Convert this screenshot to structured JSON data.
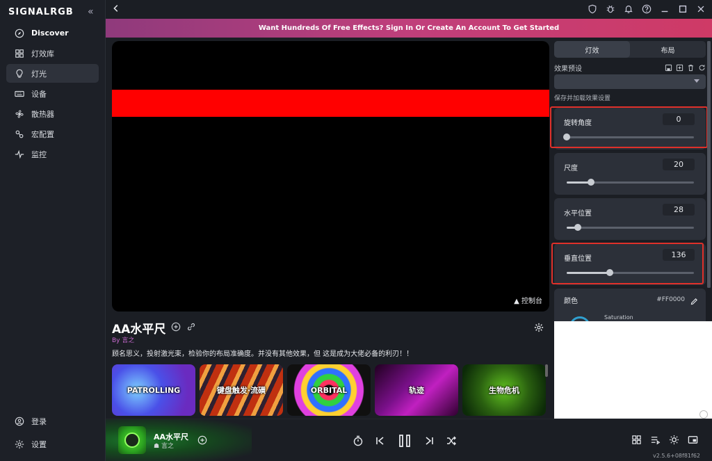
{
  "sidebar": {
    "logo": "SIGNALRGB",
    "collapse": "«",
    "items": [
      {
        "label": "Discover"
      },
      {
        "label": "灯效库"
      },
      {
        "label": "灯光"
      },
      {
        "label": "设备"
      },
      {
        "label": "散热器"
      },
      {
        "label": "宏配置"
      },
      {
        "label": "监控"
      }
    ],
    "bottom": [
      {
        "label": "登录"
      },
      {
        "label": "设置"
      }
    ]
  },
  "banner": {
    "text": "Want Hundreds Of Free Effects? Sign In Or Create An Account To Get Started"
  },
  "preview": {
    "console_label": "▲ 控制台",
    "effect_color": "#FF0000"
  },
  "effect": {
    "title": "AA水平尺",
    "author_prefix": "By",
    "author": "言之",
    "description": "顾名思义，投射激光束，检验你的布局准确度。并没有其他效果，但 这是成为大佬必备的利刃！！"
  },
  "thumbnails": [
    {
      "label": "PATROLLING"
    },
    {
      "label": "键盘触发·流磺"
    },
    {
      "label": "ORBITAL"
    },
    {
      "label": "轨迹"
    },
    {
      "label": "生物危机"
    }
  ],
  "right_panel": {
    "tabs": [
      {
        "label": "灯效"
      },
      {
        "label": "布局"
      }
    ],
    "preset_label": "效果预设",
    "save_note": "保存并加载效果设置",
    "sliders": [
      {
        "label": "旋转角度",
        "value": "0",
        "fraction": 0.0
      },
      {
        "label": "尺度",
        "value": "20",
        "fraction": 0.19
      },
      {
        "label": "水平位置",
        "value": "28",
        "fraction": 0.09
      },
      {
        "label": "垂直位置",
        "value": "136",
        "fraction": 0.34
      }
    ],
    "color": {
      "label": "颜色",
      "hex": "#FF0000",
      "saturation_label": "Saturation"
    }
  },
  "now_playing": {
    "title": "AA水平尺",
    "author": "言之"
  },
  "version": "v2.5.6+08f81f62",
  "colors": {
    "accent_highlight": "#e0302a",
    "banner_start": "#8f3a7c",
    "banner_end": "#cf3a66"
  }
}
